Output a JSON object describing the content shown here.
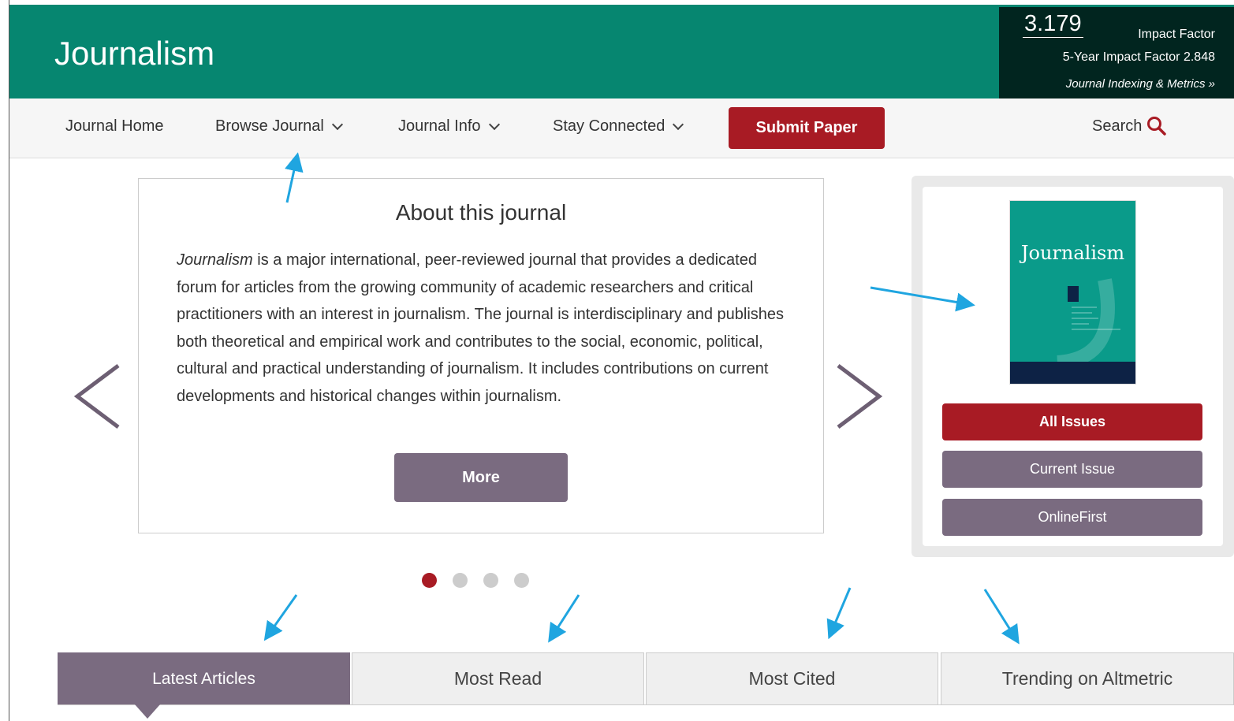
{
  "header": {
    "title": "Journalism",
    "impact_factor_value": "3.179",
    "impact_factor_label": "Impact Factor",
    "five_year_impact": "5-Year Impact Factor 2.848",
    "metrics_link": "Journal Indexing & Metrics »"
  },
  "nav": {
    "items": [
      {
        "label": "Journal Home",
        "has_dropdown": false
      },
      {
        "label": "Browse Journal",
        "has_dropdown": true
      },
      {
        "label": "Journal Info",
        "has_dropdown": true
      },
      {
        "label": "Stay Connected",
        "has_dropdown": true
      }
    ],
    "submit_label": "Submit Paper",
    "search_label": "Search"
  },
  "about": {
    "title": "About this journal",
    "text_emphasis": "Journalism",
    "text_body": " is a major international, peer-reviewed journal that provides a dedicated forum for articles from the growing community of academic researchers and critical practitioners with an interest in journalism. The journal is interdisciplinary and publishes both theoretical and empirical work and contributes to the social, economic, political, cultural and practical understanding of journalism. It includes contributions on current developments and historical changes within journalism.",
    "more_label": "More"
  },
  "carousel": {
    "dot_count": 4,
    "active_index": 0
  },
  "side_panel": {
    "cover_title": "Journalism",
    "all_issues_label": "All Issues",
    "current_issue_label": "Current Issue",
    "onlinefirst_label": "OnlineFirst"
  },
  "tabs": [
    {
      "label": "Latest Articles",
      "active": true
    },
    {
      "label": "Most Read",
      "active": false
    },
    {
      "label": "Most Cited",
      "active": false
    },
    {
      "label": "Trending on Altmetric",
      "active": false
    }
  ],
  "colors": {
    "header_bg": "#068670",
    "accent_red": "#a81b24",
    "accent_purple": "#7a6b80",
    "annotation_blue": "#1fa5e0"
  }
}
